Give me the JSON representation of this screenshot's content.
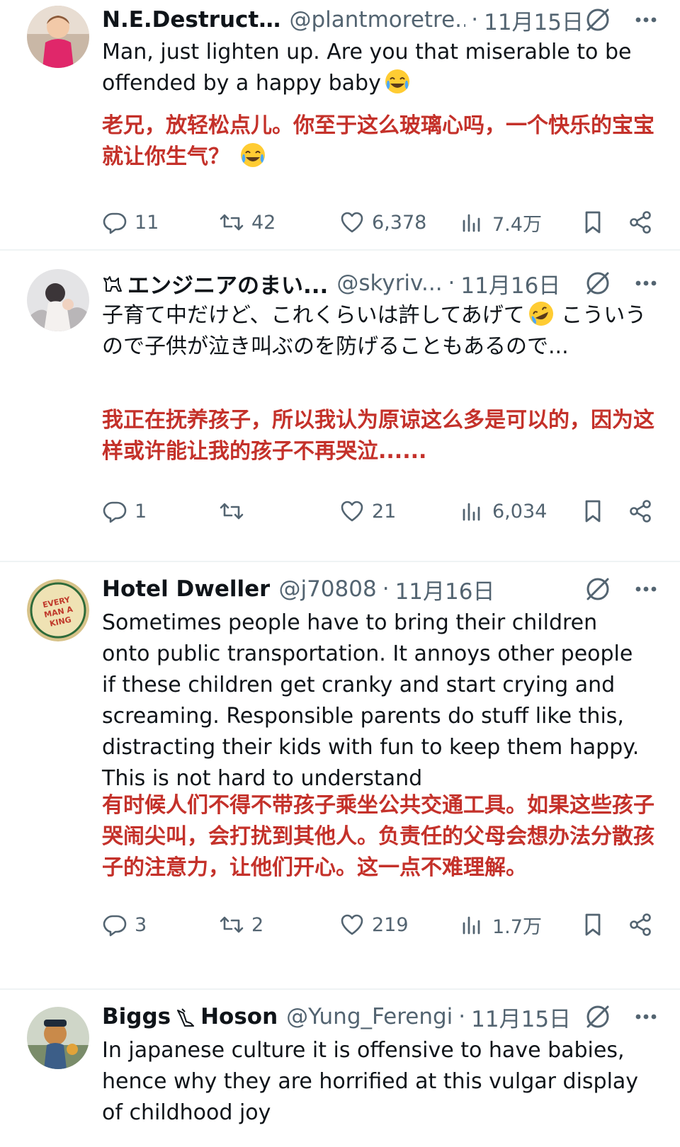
{
  "tweets": [
    {
      "name": "N.E.Destructi...",
      "handle": "@plantmoretre...",
      "date": "11月15日",
      "text": "Man, just lighten up. Are you that miserable to be offended by a happy baby",
      "emoji": "face-with-tears-of-joy",
      "translation": "老兄，放轻松点儿。你至于这么玻璃心吗，一个快乐的宝宝就让你生气？",
      "replies": "11",
      "retweets": "42",
      "likes": "6,378",
      "views": "7.4万"
    },
    {
      "name_prefix_icon": "dog-badge",
      "name": "エンジニアのまい...",
      "handle": "@skyriv...",
      "date": "11月16日",
      "text_part1": "子育て中だけど、これくらいは許してあげて",
      "text_part2": " こういうので子供が泣き叫ぶのを防げることもあるので...",
      "emoji": "rolling-on-floor-laughing",
      "translation": "我正在抚养孩子，所以我认为原谅这么多是可以的，因为这样或许能让我的孩子不再哭泣......",
      "replies": "1",
      "retweets": "",
      "likes": "21",
      "views": "6,034"
    },
    {
      "name": "Hotel Dweller",
      "handle": "@j70808",
      "date": "11月16日",
      "text": "Sometimes people have to bring their children onto public transportation. It annoys other people if these children get cranky and start crying and screaming. Responsible parents do stuff like this, distracting their kids with fun to keep them happy. This is not hard to understand",
      "translation": "有时候人们不得不带孩子乘坐公共交通工具。如果这些孩子哭闹尖叫，会打扰到其他人。负责任的父母会想办法分散孩子的注意力，让他们开心。这一点不难理解。",
      "avatar_text": "EVERY MAN A KING",
      "replies": "3",
      "retweets": "2",
      "likes": "219",
      "views": "1.7万"
    },
    {
      "name_first": "Biggs",
      "name_last": "Hoson",
      "name_icon": "bird-badge",
      "handle": "@Yung_Ferengi",
      "date": "11月15日",
      "text": "In japanese culture it is offensive to have babies, hence why they are horrified at this vulgar display of childhood joy"
    }
  ],
  "colors": {
    "text": "#0f1419",
    "secondary": "#536471",
    "translation": "#c4312a",
    "divider": "#eff3f4"
  }
}
